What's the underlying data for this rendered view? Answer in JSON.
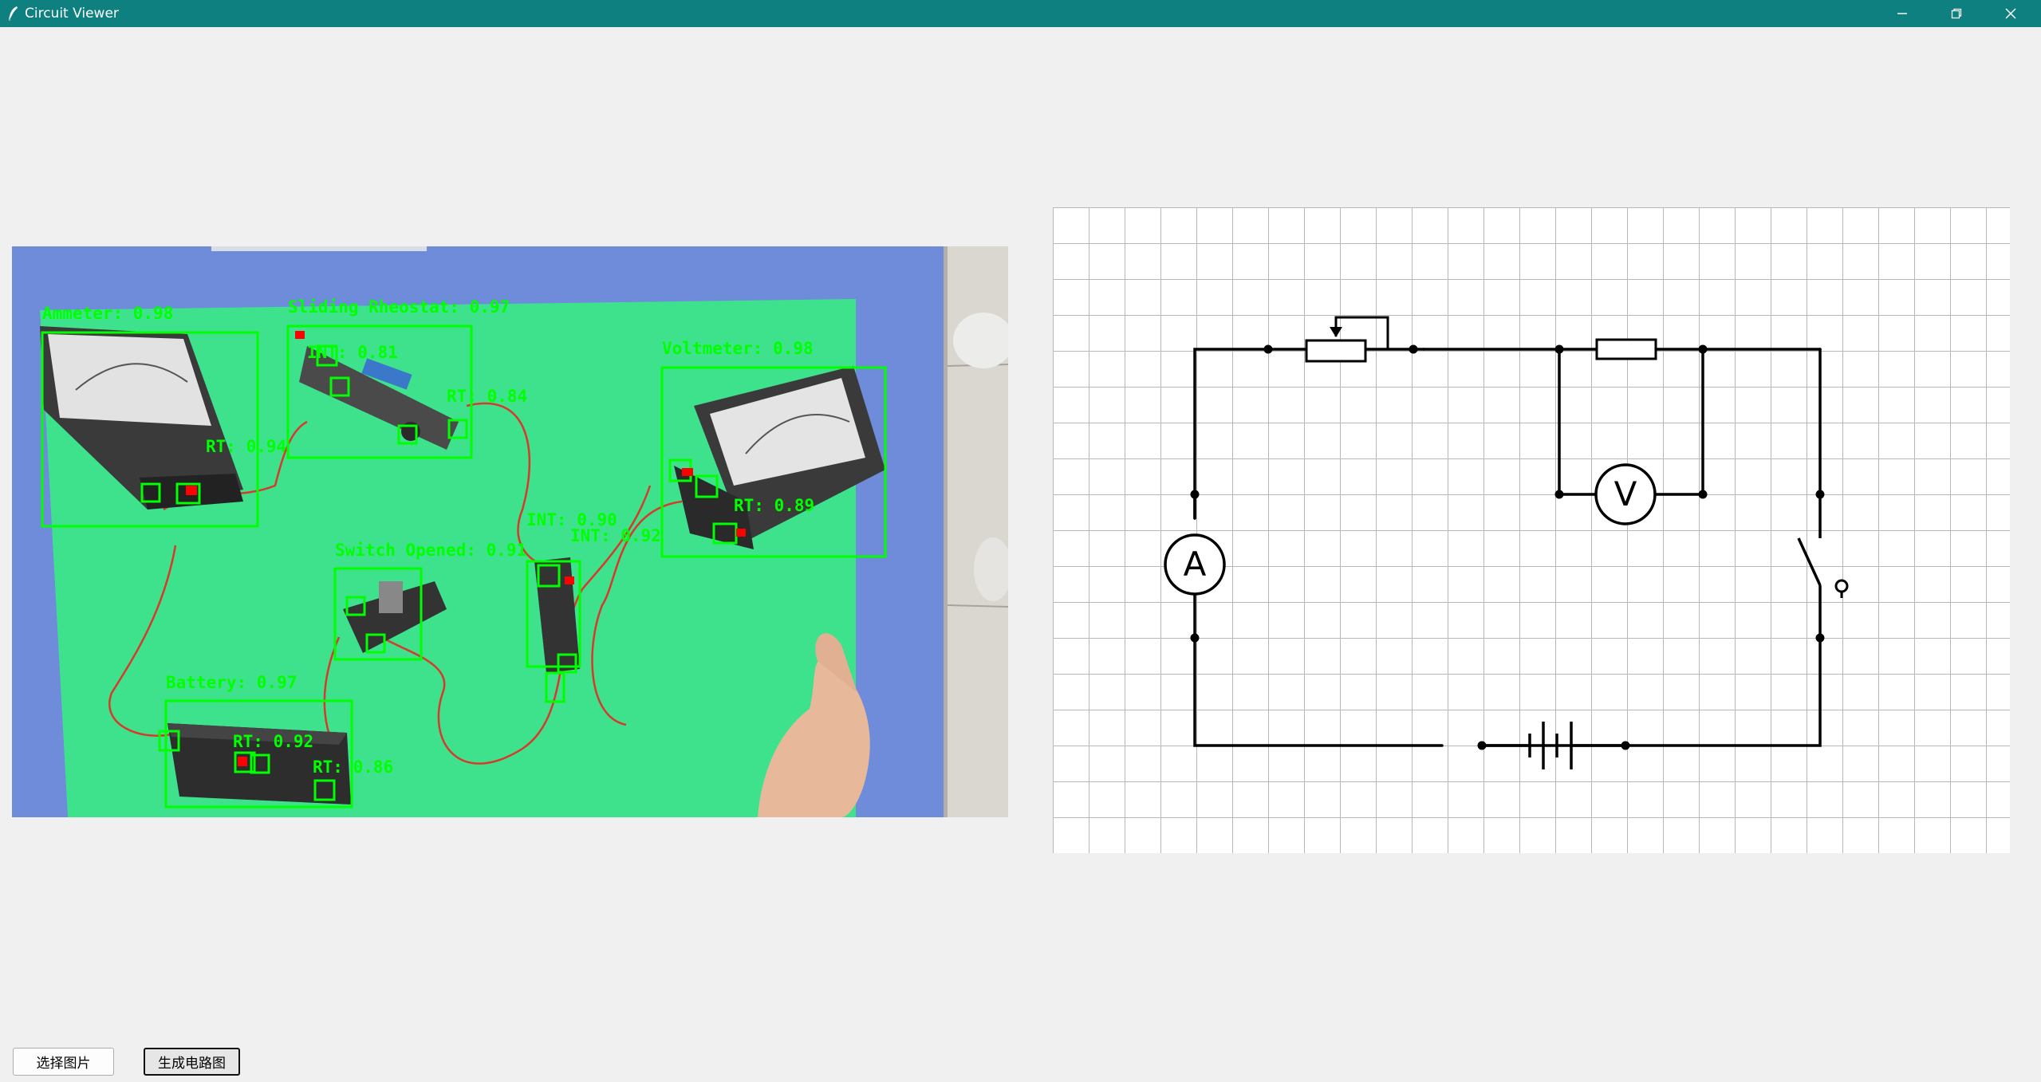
{
  "window": {
    "title": "Circuit Viewer",
    "controls": [
      "minimize",
      "restore",
      "close"
    ],
    "titlebar_color": "#0f8080"
  },
  "photo": {
    "background_color": "#6f8cdb",
    "mat_color": "#3ee28c",
    "box_color": "#00ff00",
    "terminal_color": "#ff0000",
    "detections": [
      {
        "label": "Ammeter: 0.98"
      },
      {
        "label": "Sliding Rheostat: 0.97"
      },
      {
        "label": "Voltmeter: 0.98"
      },
      {
        "label": "Switch Opened: 0.91"
      },
      {
        "label": "Battery: 0.97"
      },
      {
        "label": "INT: 0.81"
      },
      {
        "label": "RT: 0.84"
      },
      {
        "label": "RT: 0.94"
      },
      {
        "label": "RT: 0.89"
      },
      {
        "label": "INT: 0.90"
      },
      {
        "label": "INT: 0.92"
      },
      {
        "label": "RT: 0.92"
      },
      {
        "label": "RT: 0.86"
      }
    ]
  },
  "schematic": {
    "meter_ammeter": "A",
    "meter_voltmeter": "V",
    "components": [
      "sliding-rheostat",
      "resistor",
      "voltmeter",
      "ammeter",
      "switch",
      "battery"
    ]
  },
  "buttons": {
    "select_image": "选择图片",
    "generate_circuit": "生成电路图"
  }
}
